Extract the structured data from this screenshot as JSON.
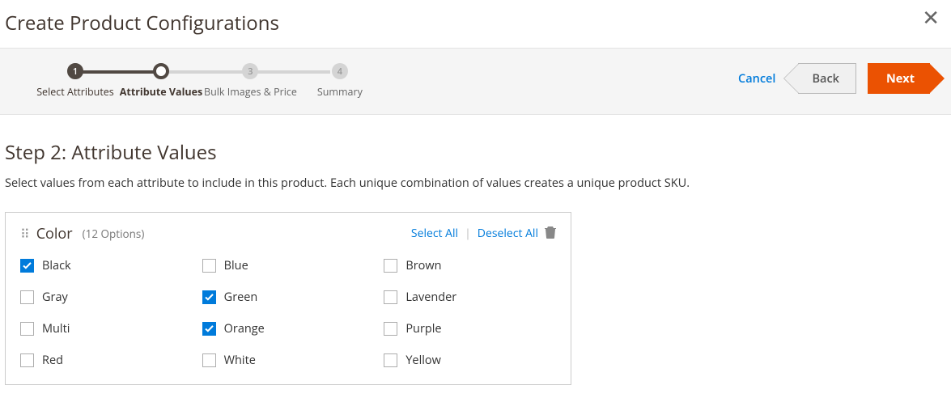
{
  "modal": {
    "title": "Create Product Configurations"
  },
  "wizard": {
    "steps": [
      {
        "num": "1",
        "label": "Select Attributes"
      },
      {
        "num": "",
        "label": "Attribute Values"
      },
      {
        "num": "3",
        "label": "Bulk Images & Price"
      },
      {
        "num": "4",
        "label": "Summary"
      }
    ]
  },
  "actions": {
    "cancel": "Cancel",
    "back": "Back",
    "next": "Next"
  },
  "content": {
    "heading": "Step 2: Attribute Values",
    "description": "Select values from each attribute to include in this product. Each unique combination of values creates a unique product SKU."
  },
  "attribute": {
    "name": "Color",
    "count": "(12 Options)",
    "selectAll": "Select All",
    "deselectAll": "Deselect All",
    "options": [
      {
        "label": "Black",
        "checked": true
      },
      {
        "label": "Blue",
        "checked": false
      },
      {
        "label": "Brown",
        "checked": false
      },
      {
        "label": "Gray",
        "checked": false
      },
      {
        "label": "Green",
        "checked": true
      },
      {
        "label": "Lavender",
        "checked": false
      },
      {
        "label": "Multi",
        "checked": false
      },
      {
        "label": "Orange",
        "checked": true
      },
      {
        "label": "Purple",
        "checked": false
      },
      {
        "label": "Red",
        "checked": false
      },
      {
        "label": "White",
        "checked": false
      },
      {
        "label": "Yellow",
        "checked": false
      }
    ]
  }
}
